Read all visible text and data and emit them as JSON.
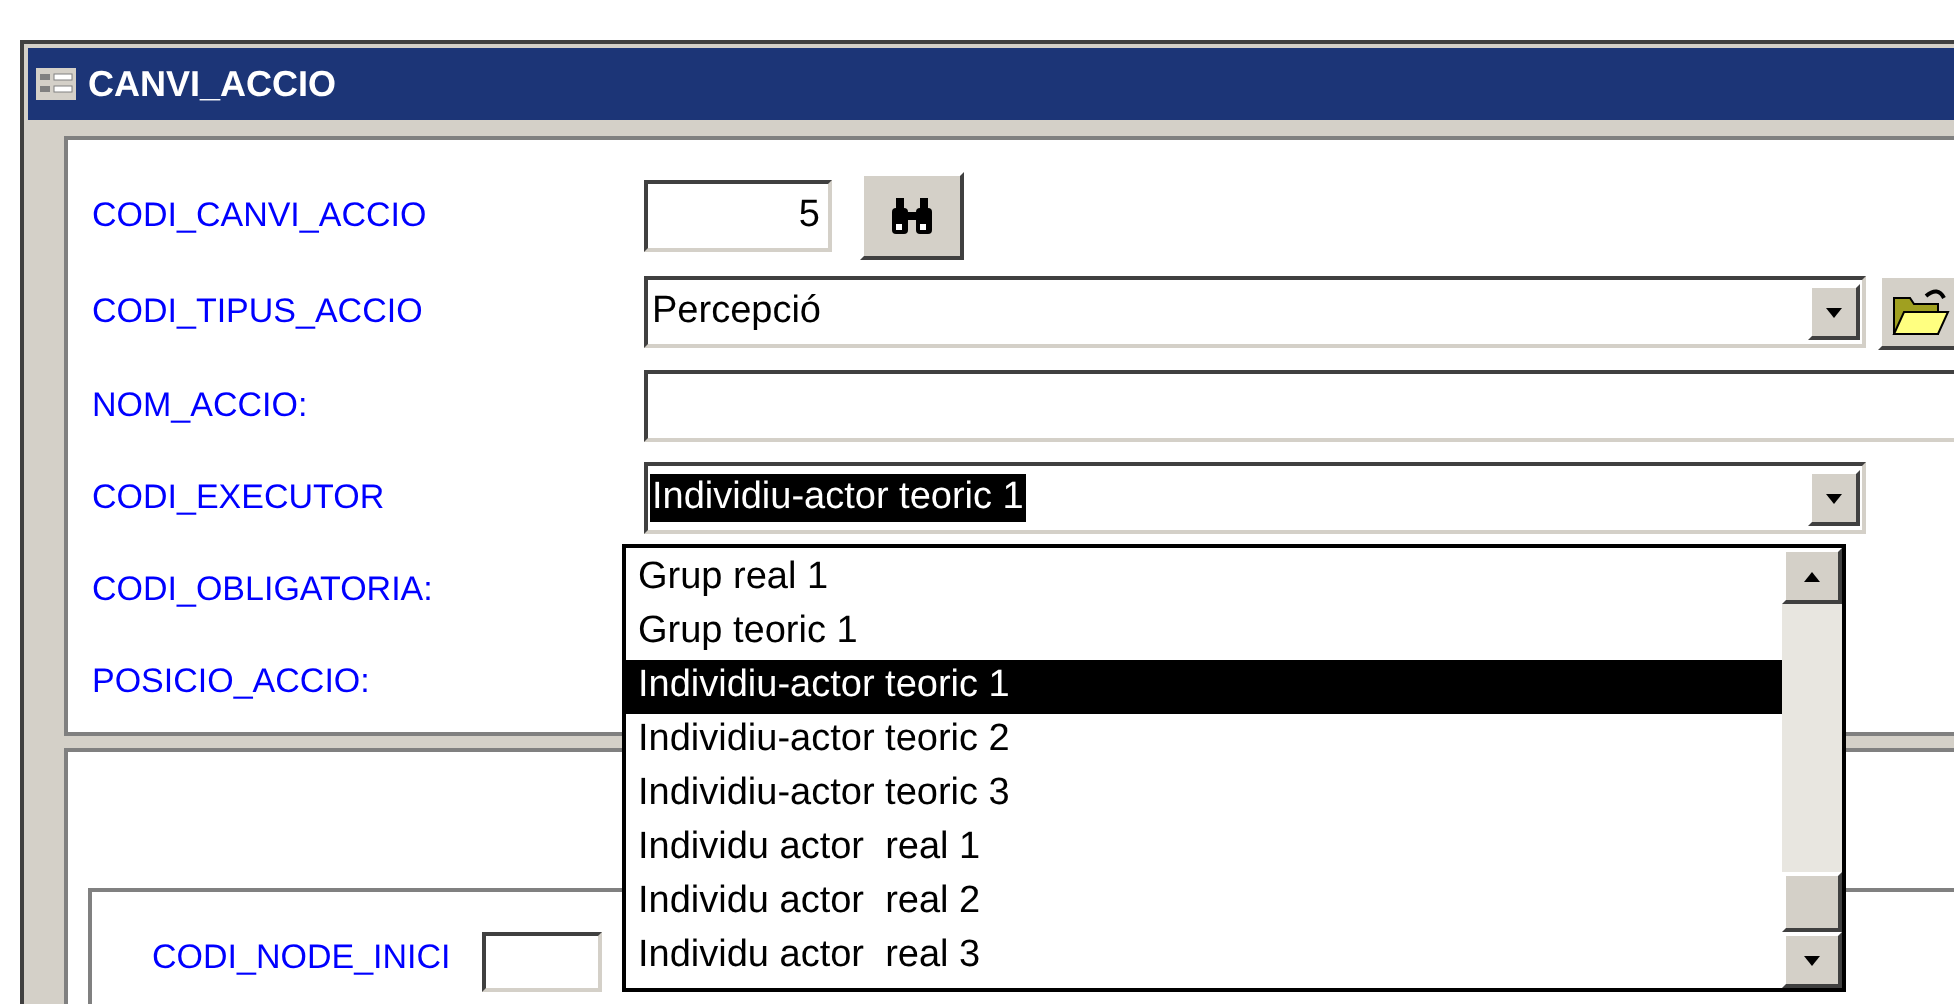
{
  "window": {
    "title": "CANVI_ACCIO"
  },
  "fields": [
    {
      "label": "CODI_CANVI_ACCIO",
      "kind": "number",
      "value": "5"
    },
    {
      "label": "CODI_TIPUS_ACCIO",
      "kind": "combo",
      "value": "Percepció",
      "highlighted": false
    },
    {
      "label": "NOM_ACCIO:",
      "kind": "wide"
    },
    {
      "label": "CODI_EXECUTOR",
      "kind": "combo",
      "value": "Individiu-actor teoric 1",
      "highlighted": true
    },
    {
      "label": "CODI_OBLIGATORIA:",
      "kind": "covered"
    },
    {
      "label": "POSICIO_ACCIO:",
      "kind": "covered"
    }
  ],
  "dropdown": {
    "items": [
      {
        "label": "Grup real 1",
        "selected": false
      },
      {
        "label": "Grup teoric 1",
        "selected": false
      },
      {
        "label": "Individiu-actor teoric 1",
        "selected": true
      },
      {
        "label": "Individiu-actor teoric 2",
        "selected": false
      },
      {
        "label": "Individiu-actor teoric 3",
        "selected": false
      },
      {
        "label": "Individu actor  real 1",
        "selected": false
      },
      {
        "label": "Individu actor  real 2",
        "selected": false
      },
      {
        "label": "Individu actor  real 3",
        "selected": false
      }
    ]
  },
  "subform": {
    "fields": [
      {
        "label": "CODI_NODE_INICI"
      }
    ]
  }
}
